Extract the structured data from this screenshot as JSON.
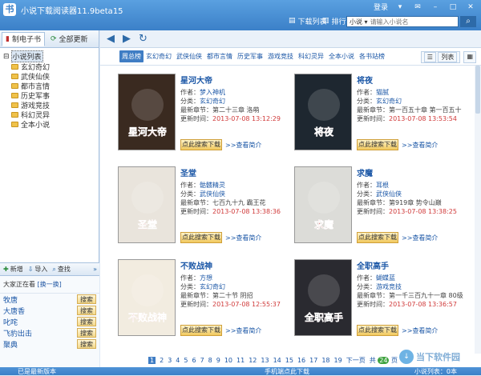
{
  "window": {
    "title": "小说下载阅读器11.9beta15",
    "login": "登录"
  },
  "toolbar": {
    "download_list": "下载列表",
    "ranking": "排行榜"
  },
  "search": {
    "scope": "小说",
    "placeholder": "请输入小说名",
    "button_icon": "search-icon"
  },
  "left_tabs": [
    {
      "label": "制电子书"
    },
    {
      "label": "全部更新"
    }
  ],
  "tree": {
    "root": "小说列表",
    "items": [
      "玄幻奇幻",
      "武侠仙侠",
      "都市言情",
      "历史军事",
      "游戏竞技",
      "科幻灵异",
      "全本小说"
    ]
  },
  "watch_toolbar": {
    "add": "新增",
    "import": "导入",
    "find": "查找"
  },
  "watch": {
    "heading": "大家正在看",
    "refresh": "[换一换]",
    "items": [
      {
        "name": "牧唐",
        "action": "搜索"
      },
      {
        "name": "大唐香",
        "action": "搜索"
      },
      {
        "name": "叱咤",
        "action": "搜索"
      },
      {
        "name": "飞豹出击",
        "action": "搜索"
      },
      {
        "name": "聚典",
        "action": "搜索"
      }
    ]
  },
  "categories": [
    "周总榜",
    "玄幻奇幻",
    "武侠仙侠",
    "都市言情",
    "历史军事",
    "游戏竞技",
    "科幻灵异",
    "全本小说",
    "各书站榜"
  ],
  "view_modes": {
    "list": "列表",
    "grid": "▦"
  },
  "books": [
    {
      "title": "星河大帝",
      "author": "梦入神机",
      "category": "玄幻奇幻",
      "latest": "第二十三章 洛萌",
      "updated": "2013-07-08 13:12:29",
      "cover_text": "星河大帝",
      "cover_bg": "#3a2a20"
    },
    {
      "title": "将夜",
      "author": "猫腻",
      "category": "玄幻奇幻",
      "latest": "第一百五十章 第一百五十",
      "updated": "2013-07-08 13:53:54",
      "cover_text": "将夜",
      "cover_bg": "#1e2730"
    },
    {
      "title": "圣堂",
      "author": "骷髅精灵",
      "category": "武侠仙侠",
      "latest": "七百九十九 霸王花",
      "updated": "2013-07-08 13:38:36",
      "cover_text": "圣堂",
      "cover_bg": "#e9e4dc"
    },
    {
      "title": "求魔",
      "author": "耳根",
      "category": "武侠仙侠",
      "latest": "第919章 势令山巅",
      "updated": "2013-07-08 13:38:25",
      "cover_text": "求魔",
      "cover_bg": "#dcdcd8"
    },
    {
      "title": "不败战神",
      "author": "方想",
      "category": "玄幻奇幻",
      "latest": "第二十节 阴招",
      "updated": "2013-07-08 12:55:37",
      "cover_text": "不败战神",
      "cover_bg": "#f2ece0"
    },
    {
      "title": "全职高手",
      "author": "蝴蝶蓝",
      "category": "游戏竞技",
      "latest": "第一千三百九十一章 80级",
      "updated": "2013-07-08 13:36:57",
      "cover_text": "全职高手",
      "cover_bg": "#2a2a30"
    }
  ],
  "card_labels": {
    "author": "作者：",
    "category": "分类：",
    "latest": "最新章节：",
    "updated": "更新时间：",
    "download": "点此搜索下载",
    "intro": ">>查看简介"
  },
  "pager": {
    "pages": [
      "1",
      "2",
      "3",
      "4",
      "5",
      "6",
      "7",
      "8",
      "9",
      "10",
      "11",
      "12",
      "13",
      "14",
      "15",
      "16",
      "17",
      "18",
      "19"
    ],
    "current": "1",
    "next": "下一页",
    "total": "共",
    "total_count": "24",
    "total_suffix": "页"
  },
  "status": {
    "left": "已是最新版本",
    "center": "手机端点此下载",
    "right": "小说列表：0本"
  },
  "watermark": {
    "text": "当下软件园"
  }
}
